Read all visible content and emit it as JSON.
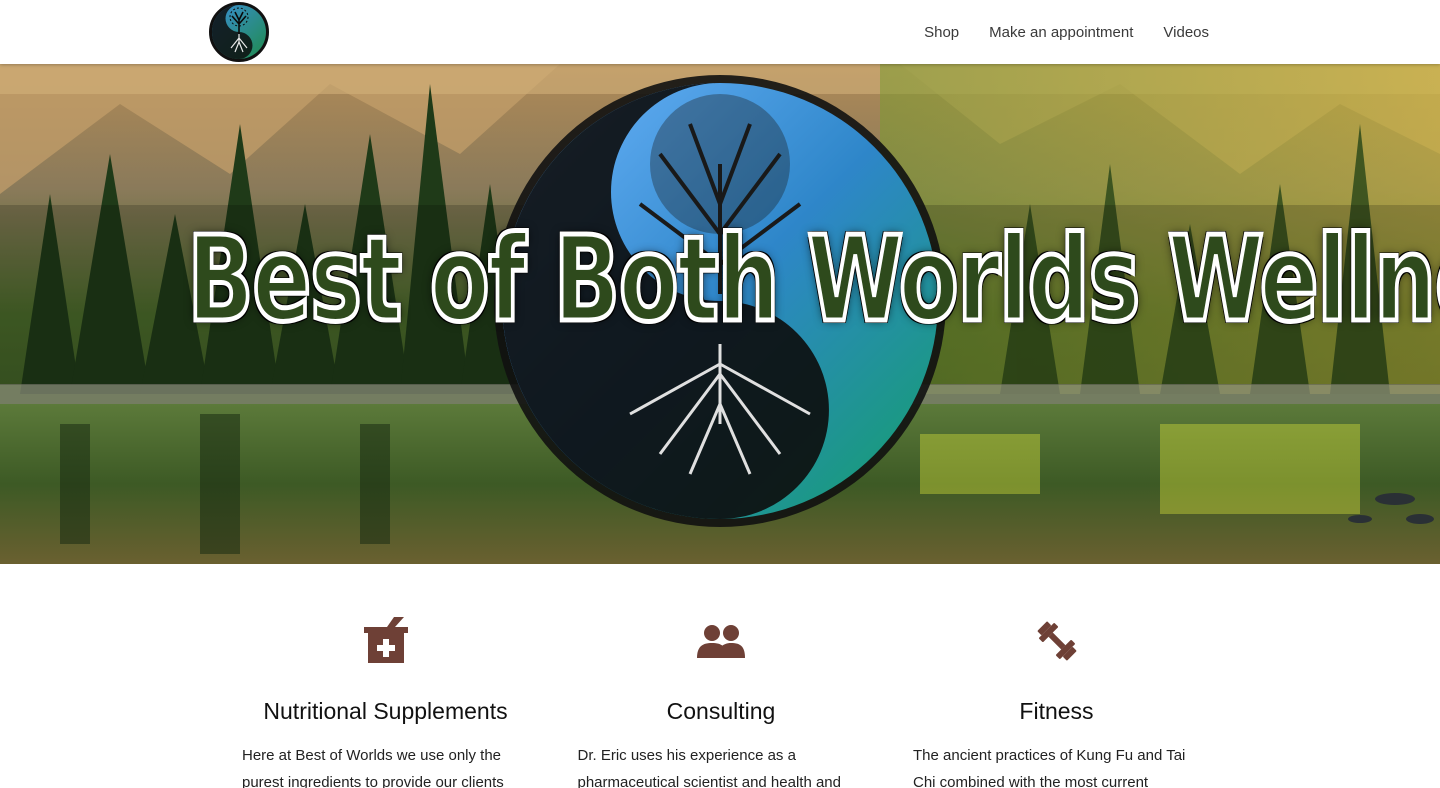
{
  "nav": {
    "links": [
      "Shop",
      "Make an appointment",
      "Videos"
    ]
  },
  "hero": {
    "title": "Best of Both Worlds Wellness"
  },
  "features": [
    {
      "icon": "mortar-pestle-plus-icon",
      "title": "Nutritional Supplements",
      "text": "Here at Best of Worlds we use only the purest ingredients to provide our clients"
    },
    {
      "icon": "people-group-icon",
      "title": "Consulting",
      "text": "Dr. Eric uses his experience as a pharmaceutical scientist and health and"
    },
    {
      "icon": "dumbbell-icon",
      "title": "Fitness",
      "text": "The ancient practices of Kung Fu and Tai Chi combined with the most current"
    }
  ],
  "colors": {
    "icon_brown": "#6e4036",
    "nav_text": "#3a3a3a",
    "hero_sky": "#2f6fa8",
    "hero_forest": "#3c6b2a"
  }
}
